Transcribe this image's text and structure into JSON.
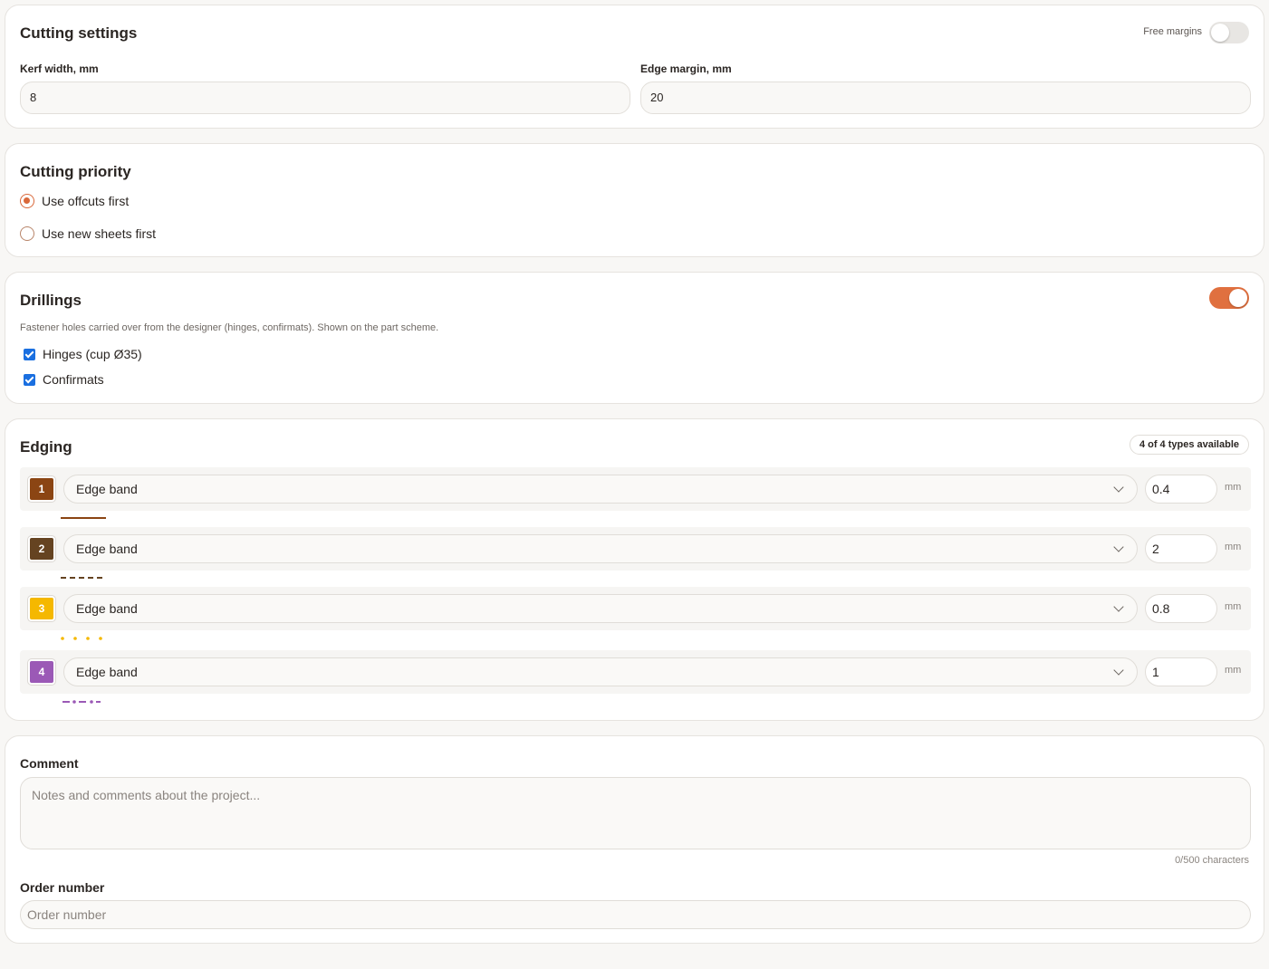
{
  "cutting_settings": {
    "title": "Cutting settings",
    "free_margins_label": "Free margins",
    "free_margins_on": false,
    "kerf_label": "Kerf width, mm",
    "kerf_value": "8",
    "edge_margin_label": "Edge margin, mm",
    "edge_margin_value": "20"
  },
  "cutting_priority": {
    "title": "Cutting priority",
    "options": [
      {
        "label": "Use offcuts first",
        "checked": true
      },
      {
        "label": "Use new sheets first",
        "checked": false
      }
    ]
  },
  "drillings": {
    "title": "Drillings",
    "enabled": true,
    "description": "Fastener holes carried over from the designer (hinges, confirmats). Shown on the part scheme.",
    "options": [
      {
        "label": "Hinges (cup Ø35)",
        "checked": true
      },
      {
        "label": "Confirmats",
        "checked": true
      }
    ]
  },
  "edging": {
    "title": "Edging",
    "badge": "4 of 4 types available",
    "unit": "mm",
    "items": [
      {
        "number": "1",
        "type": "Edge band",
        "thickness": "0.4",
        "color": "#8b4513",
        "line_style": "solid"
      },
      {
        "number": "2",
        "type": "Edge band",
        "thickness": "2",
        "color": "#654321",
        "line_style": "dashed"
      },
      {
        "number": "3",
        "type": "Edge band",
        "thickness": "0.8",
        "color": "#f5b800",
        "line_style": "dotted"
      },
      {
        "number": "4",
        "type": "Edge band",
        "thickness": "1",
        "color": "#9b59b6",
        "line_style": "dash-dot"
      }
    ]
  },
  "comment": {
    "label": "Comment",
    "placeholder": "Notes and comments about the project...",
    "counter": "0/500 characters"
  },
  "order": {
    "label": "Order number",
    "placeholder": "Order number"
  },
  "colors": {
    "accent": "#e0703f",
    "checkbox": "#1a6fe0"
  }
}
